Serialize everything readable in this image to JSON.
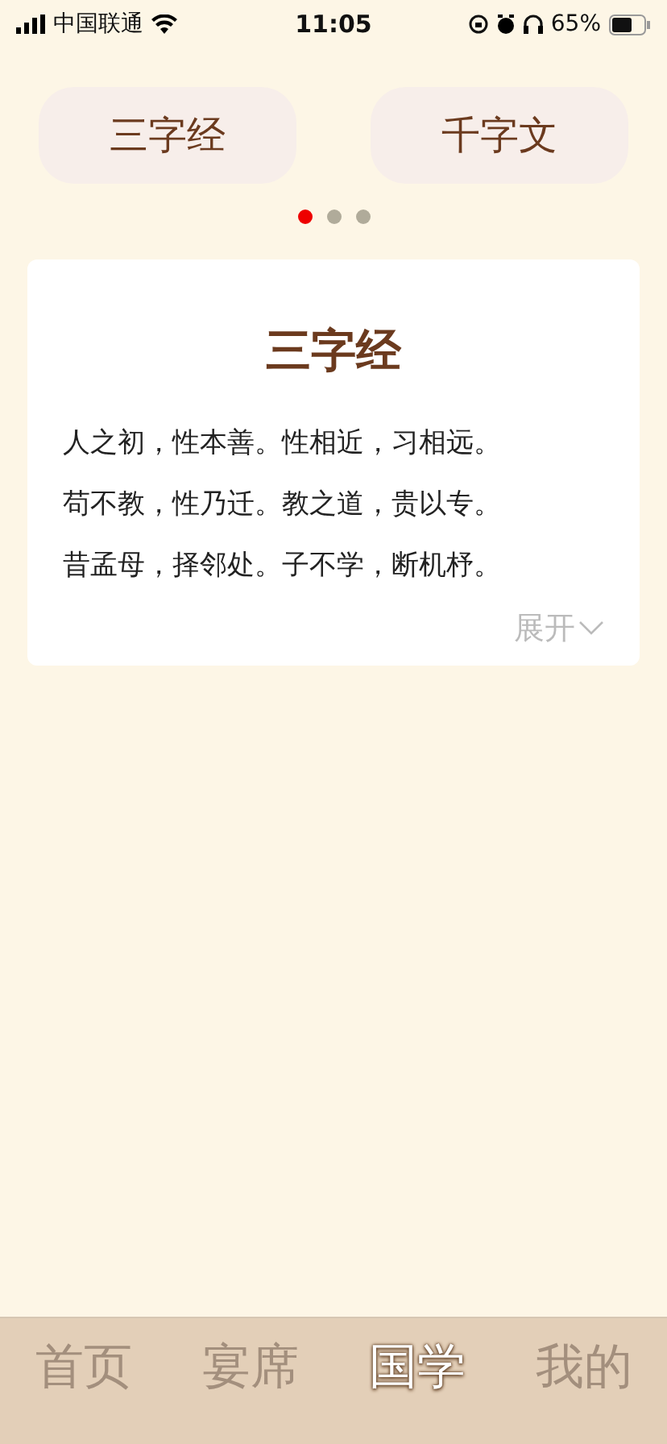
{
  "status_bar": {
    "carrier": "中国联通",
    "time": "11:05",
    "battery": "65%"
  },
  "categories": [
    {
      "label": "三字经"
    },
    {
      "label": "千字文"
    }
  ],
  "pager": [
    {
      "selected": true
    },
    {
      "selected": false
    },
    {
      "selected": false
    }
  ],
  "card": {
    "title": "三字经",
    "lines": [
      "人之初，性本善。性相近，习相远。",
      "苟不教，性乃迁。教之道，贵以专。",
      "昔孟母，择邻处。子不学，断机杼。"
    ],
    "expand": "展开"
  },
  "tab_bar": [
    {
      "label": "首页",
      "selected": false
    },
    {
      "label": "宴席",
      "selected": false
    },
    {
      "label": "国学",
      "selected": true
    },
    {
      "label": "我的",
      "selected": false
    }
  ]
}
